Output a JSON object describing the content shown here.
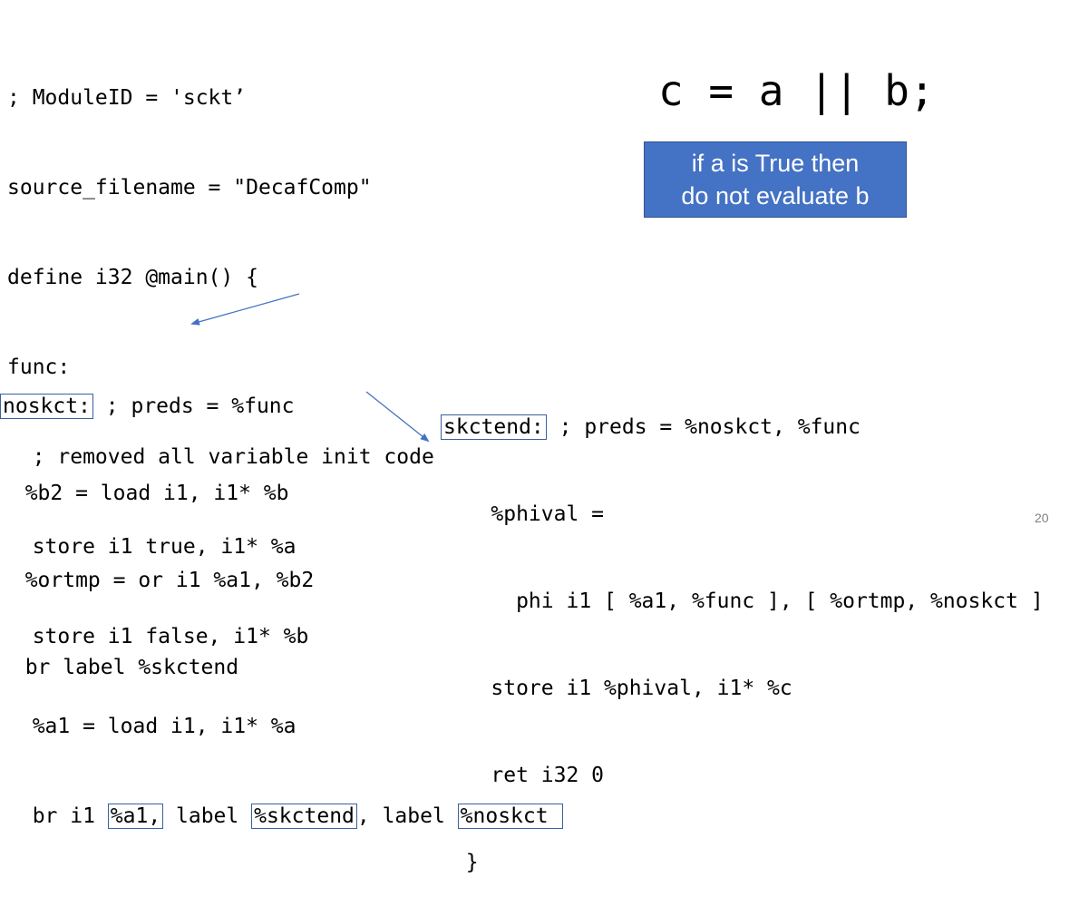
{
  "main_code": {
    "l1": "; ModuleID = 'sckt’",
    "l2": "source_filename = \"DecafComp\"",
    "l3": "define i32 @main() {",
    "l4": "func:",
    "l5": "  ; removed all variable init code",
    "l6": "  store i1 true, i1* %a",
    "l7": "  store i1 false, i1* %b",
    "l8": "  %a1 = load i1, i1* %a",
    "l9_prefix": "  br i1 ",
    "l9_a1": "%a1,",
    "l9_mid1": " label ",
    "l9_skctend": "%skctend",
    "l9_mid2": ", label ",
    "l9_noskct": "%noskct "
  },
  "noskct_block": {
    "label": "noskct:",
    "comment": " ; preds = %func",
    "l2": "  %b2 = load i1, i1* %b",
    "l3": "  %ortmp = or i1 %a1, %b2",
    "l4": "  br label %skctend"
  },
  "skctend_block": {
    "label": "skctend:",
    "comment": " ; preds = %noskct, %func",
    "l2": "    %phival =",
    "l3": "      phi i1 [ %a1, %func ], [ %ortmp, %noskct ]",
    "l4": "    store i1 %phival, i1* %c",
    "l5": "    ret i32 0",
    "l6": "  }"
  },
  "expression": "c = a || b;",
  "callout": {
    "line1": "if a is True then",
    "line2": "do not evaluate b"
  },
  "page_number": "20",
  "colors": {
    "callout_fill": "#4472c4",
    "box_border": "#3b5fa0",
    "arrow": "#4472c4"
  }
}
